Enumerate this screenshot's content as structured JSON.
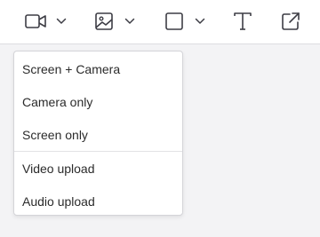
{
  "toolbar": {
    "buttons": [
      {
        "icon": "video-camera-icon",
        "has_dropdown": true
      },
      {
        "icon": "image-icon",
        "has_dropdown": true
      },
      {
        "icon": "square-shape-icon",
        "has_dropdown": true
      },
      {
        "icon": "text-icon",
        "has_dropdown": false
      },
      {
        "icon": "external-link-icon",
        "has_dropdown": false
      }
    ],
    "icon_color": "#3d3d45"
  },
  "menu": {
    "items": [
      {
        "label": "Screen + Camera"
      },
      {
        "label": "Camera only"
      },
      {
        "label": "Screen only"
      },
      {
        "label": "Video upload"
      },
      {
        "label": "Audio upload"
      }
    ]
  }
}
